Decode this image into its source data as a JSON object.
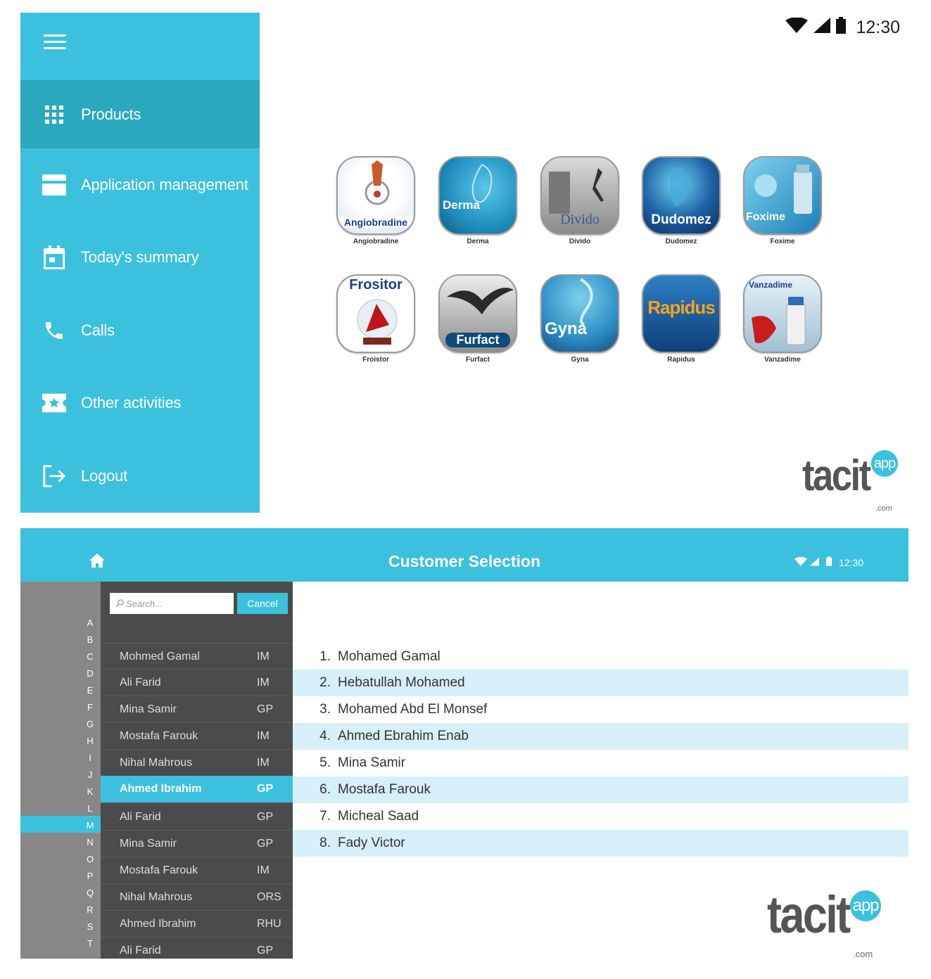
{
  "drawer": {
    "menu_icon": "hamburger-icon",
    "items": [
      {
        "label": "Products",
        "icon": "grid-icon",
        "active": true
      },
      {
        "label": "Application management",
        "icon": "card-icon",
        "active": false
      },
      {
        "label": "Today's summary",
        "icon": "calendar-icon",
        "active": false
      },
      {
        "label": "Calls",
        "icon": "phone-icon",
        "active": false
      },
      {
        "label": "Other activities",
        "icon": "ticket-star-icon",
        "active": false
      },
      {
        "label": "Logout",
        "icon": "logout-icon",
        "active": false
      }
    ]
  },
  "status_top": {
    "time": "12:30"
  },
  "products": [
    {
      "brand": "Angiobradine",
      "caption": "Angiobradine",
      "color": "#ffffff"
    },
    {
      "brand": "Derma",
      "caption": "Derma",
      "color": "#1f8fbf"
    },
    {
      "brand": "Divido",
      "caption": "Divido",
      "color": "#8a8a8a"
    },
    {
      "brand": "Dudomez",
      "caption": "Dudomez",
      "color": "#1c5fa3"
    },
    {
      "brand": "Foxime",
      "caption": "Foxime",
      "color": "#3aaedb"
    },
    {
      "brand": "Frositor",
      "caption": "Froistor",
      "color": "#ffffff"
    },
    {
      "brand": "Furfact",
      "caption": "Furfact",
      "color": "#9d9d9d"
    },
    {
      "brand": "Gyna",
      "caption": "Gyna",
      "color": "#2e8fc6"
    },
    {
      "brand": "Rapidus",
      "caption": "Rapidus",
      "color": "#1e66a8"
    },
    {
      "brand": "Vanzadime",
      "caption": "Vanzadime",
      "color": "#c6dbe8"
    }
  ],
  "logo": {
    "text": "tacit",
    "bubble": "app",
    "suffix": ".com"
  },
  "customer_screen": {
    "title": "Customer Selection",
    "time": "12:30",
    "search_placeholder": "Search...",
    "cancel_label": "Cancel",
    "alphabet": [
      "A",
      "B",
      "C",
      "D",
      "E",
      "F",
      "G",
      "H",
      "I",
      "J",
      "K",
      "L",
      "M",
      "N",
      "O",
      "P",
      "Q",
      "R",
      "S",
      "T"
    ],
    "selected_letter": "M",
    "doctors": [
      {
        "name": "Mohmed Gamal",
        "code": "IM"
      },
      {
        "name": "Ali Farid",
        "code": "IM"
      },
      {
        "name": "Mina Samir",
        "code": "GP"
      },
      {
        "name": "Mostafa Farouk",
        "code": "IM"
      },
      {
        "name": "Nihal Mahrous",
        "code": "IM"
      },
      {
        "name": "Ahmed Ibrahim",
        "code": "GP",
        "selected": true
      },
      {
        "name": "Ali Farid",
        "code": "GP"
      },
      {
        "name": "Mina Samir",
        "code": "GP"
      },
      {
        "name": "Mostafa Farouk",
        "code": "IM"
      },
      {
        "name": "Nihal Mahrous",
        "code": "ORS"
      },
      {
        "name": "Ahmed Ibrahim",
        "code": "RHU"
      },
      {
        "name": "Ali Farid",
        "code": "GP"
      }
    ],
    "customers": [
      {
        "index": "1.",
        "name": "Mohamed Gamal"
      },
      {
        "index": "2.",
        "name": "Hebatullah Mohamed"
      },
      {
        "index": "3.",
        "name": "Mohamed Abd El Monsef"
      },
      {
        "index": "4.",
        "name": "Ahmed Ebrahim Enab"
      },
      {
        "index": "5.",
        "name": "Mina Samir"
      },
      {
        "index": "6.",
        "name": "Mostafa Farouk"
      },
      {
        "index": "7.",
        "name": "Micheal Saad"
      },
      {
        "index": "8.",
        "name": "Fady Victor"
      }
    ]
  },
  "colors": {
    "accent": "#3bc1dd",
    "accent_dark": "#2aa8be",
    "list_bg": "#4b4b4b",
    "alpha_bg": "#878787",
    "row_alt": "#d7eff8"
  }
}
